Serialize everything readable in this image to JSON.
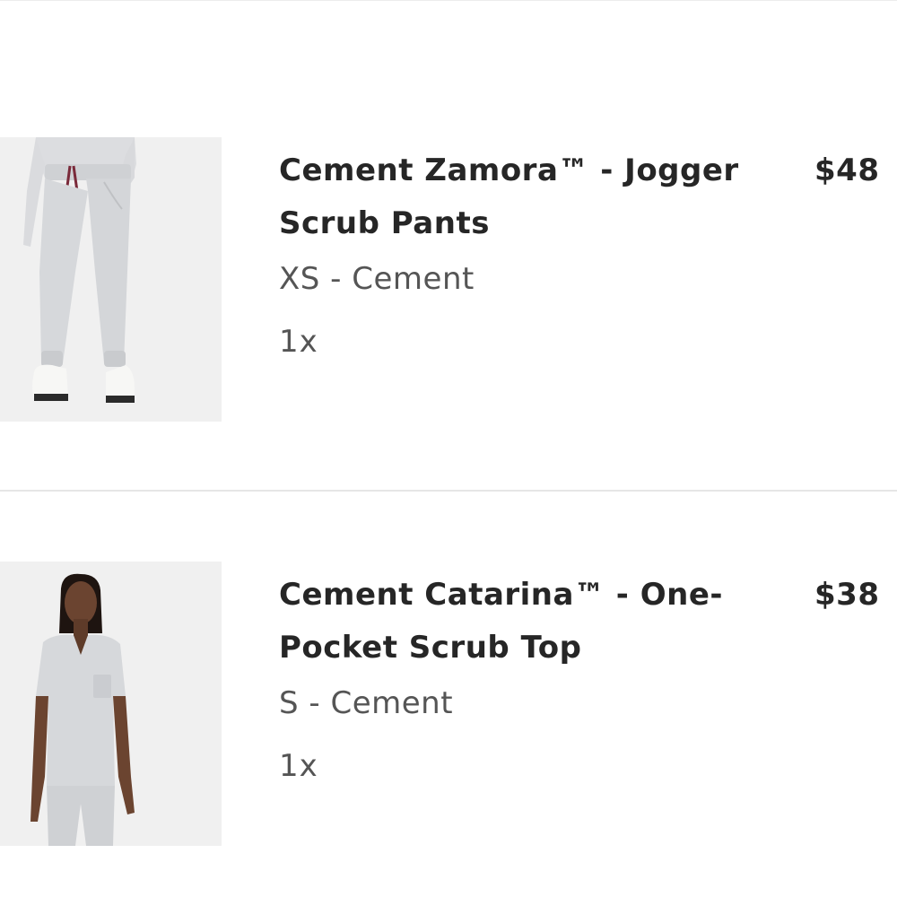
{
  "cart": {
    "items": [
      {
        "title": "Cement Zamora™ - Jogger Scrub Pants",
        "variant": "XS - Cement",
        "quantity": "1x",
        "price": "$48",
        "image_icon": "jogger-pants-product-photo"
      },
      {
        "title": "Cement Catarina™ - One-Pocket Scrub Top",
        "variant": "S - Cement",
        "quantity": "1x",
        "price": "$38",
        "image_icon": "scrub-top-product-photo"
      }
    ]
  },
  "colors": {
    "divider": "#e6e6e6",
    "title_text": "#262626",
    "secondary_text": "#555555",
    "image_background": "#efefef",
    "garment": "#d6d8db",
    "drawstring": "#7a2a3a"
  }
}
